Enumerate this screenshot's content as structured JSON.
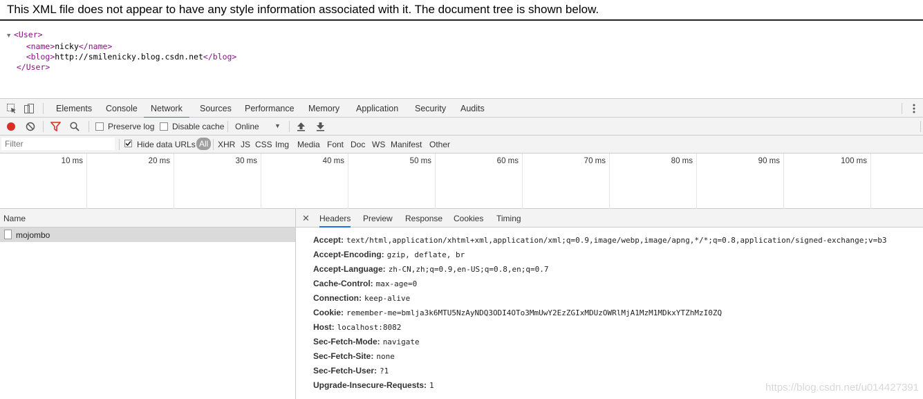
{
  "xml_notice": "This XML file does not appear to have any style information associated with it. The document tree is shown below.",
  "xml_tree": {
    "user_open": "<User>",
    "name_open": "<name>",
    "name_value": "nicky",
    "name_close": "</name>",
    "blog_open": "<blog>",
    "blog_value": "http://smilenicky.blog.csdn.net",
    "blog_close": "</blog>",
    "user_close": "</User>"
  },
  "devtools": {
    "tabs": [
      "Elements",
      "Console",
      "Network",
      "Sources",
      "Performance",
      "Memory",
      "Application",
      "Security",
      "Audits"
    ],
    "active_tab": "Network",
    "toolbar": {
      "preserve_log": "Preserve log",
      "disable_cache": "Disable cache",
      "throttle": "Online"
    },
    "filter": {
      "placeholder": "Filter",
      "hide_data_urls": "Hide data URLs",
      "types": [
        "All",
        "XHR",
        "JS",
        "CSS",
        "Img",
        "Media",
        "Font",
        "Doc",
        "WS",
        "Manifest",
        "Other"
      ]
    },
    "timeline_ticks": [
      "10 ms",
      "20 ms",
      "30 ms",
      "40 ms",
      "50 ms",
      "60 ms",
      "70 ms",
      "80 ms",
      "90 ms",
      "100 ms"
    ],
    "name_column": "Name",
    "requests": [
      "mojombo"
    ],
    "detail_tabs": [
      "Headers",
      "Preview",
      "Response",
      "Cookies",
      "Timing"
    ],
    "active_detail_tab": "Headers",
    "headers": [
      {
        "key": "Accept:",
        "value": "text/html,application/xhtml+xml,application/xml;q=0.9,image/webp,image/apng,*/*;q=0.8,application/signed-exchange;v=b3"
      },
      {
        "key": "Accept-Encoding:",
        "value": "gzip, deflate, br"
      },
      {
        "key": "Accept-Language:",
        "value": "zh-CN,zh;q=0.9,en-US;q=0.8,en;q=0.7"
      },
      {
        "key": "Cache-Control:",
        "value": "max-age=0"
      },
      {
        "key": "Connection:",
        "value": "keep-alive"
      },
      {
        "key": "Cookie:",
        "value": "remember-me=bmlja3k6MTU5NzAyNDQ3ODI4OTo3MmUwY2EzZGIxMDUzOWRlMjA1MzM1MDkxYTZhMzI0ZQ"
      },
      {
        "key": "Host:",
        "value": "localhost:8082"
      },
      {
        "key": "Sec-Fetch-Mode:",
        "value": "navigate"
      },
      {
        "key": "Sec-Fetch-Site:",
        "value": "none"
      },
      {
        "key": "Sec-Fetch-User:",
        "value": "?1"
      },
      {
        "key": "Upgrade-Insecure-Requests:",
        "value": "1"
      }
    ]
  },
  "watermark": "https://blog.csdn.net/u014427391"
}
